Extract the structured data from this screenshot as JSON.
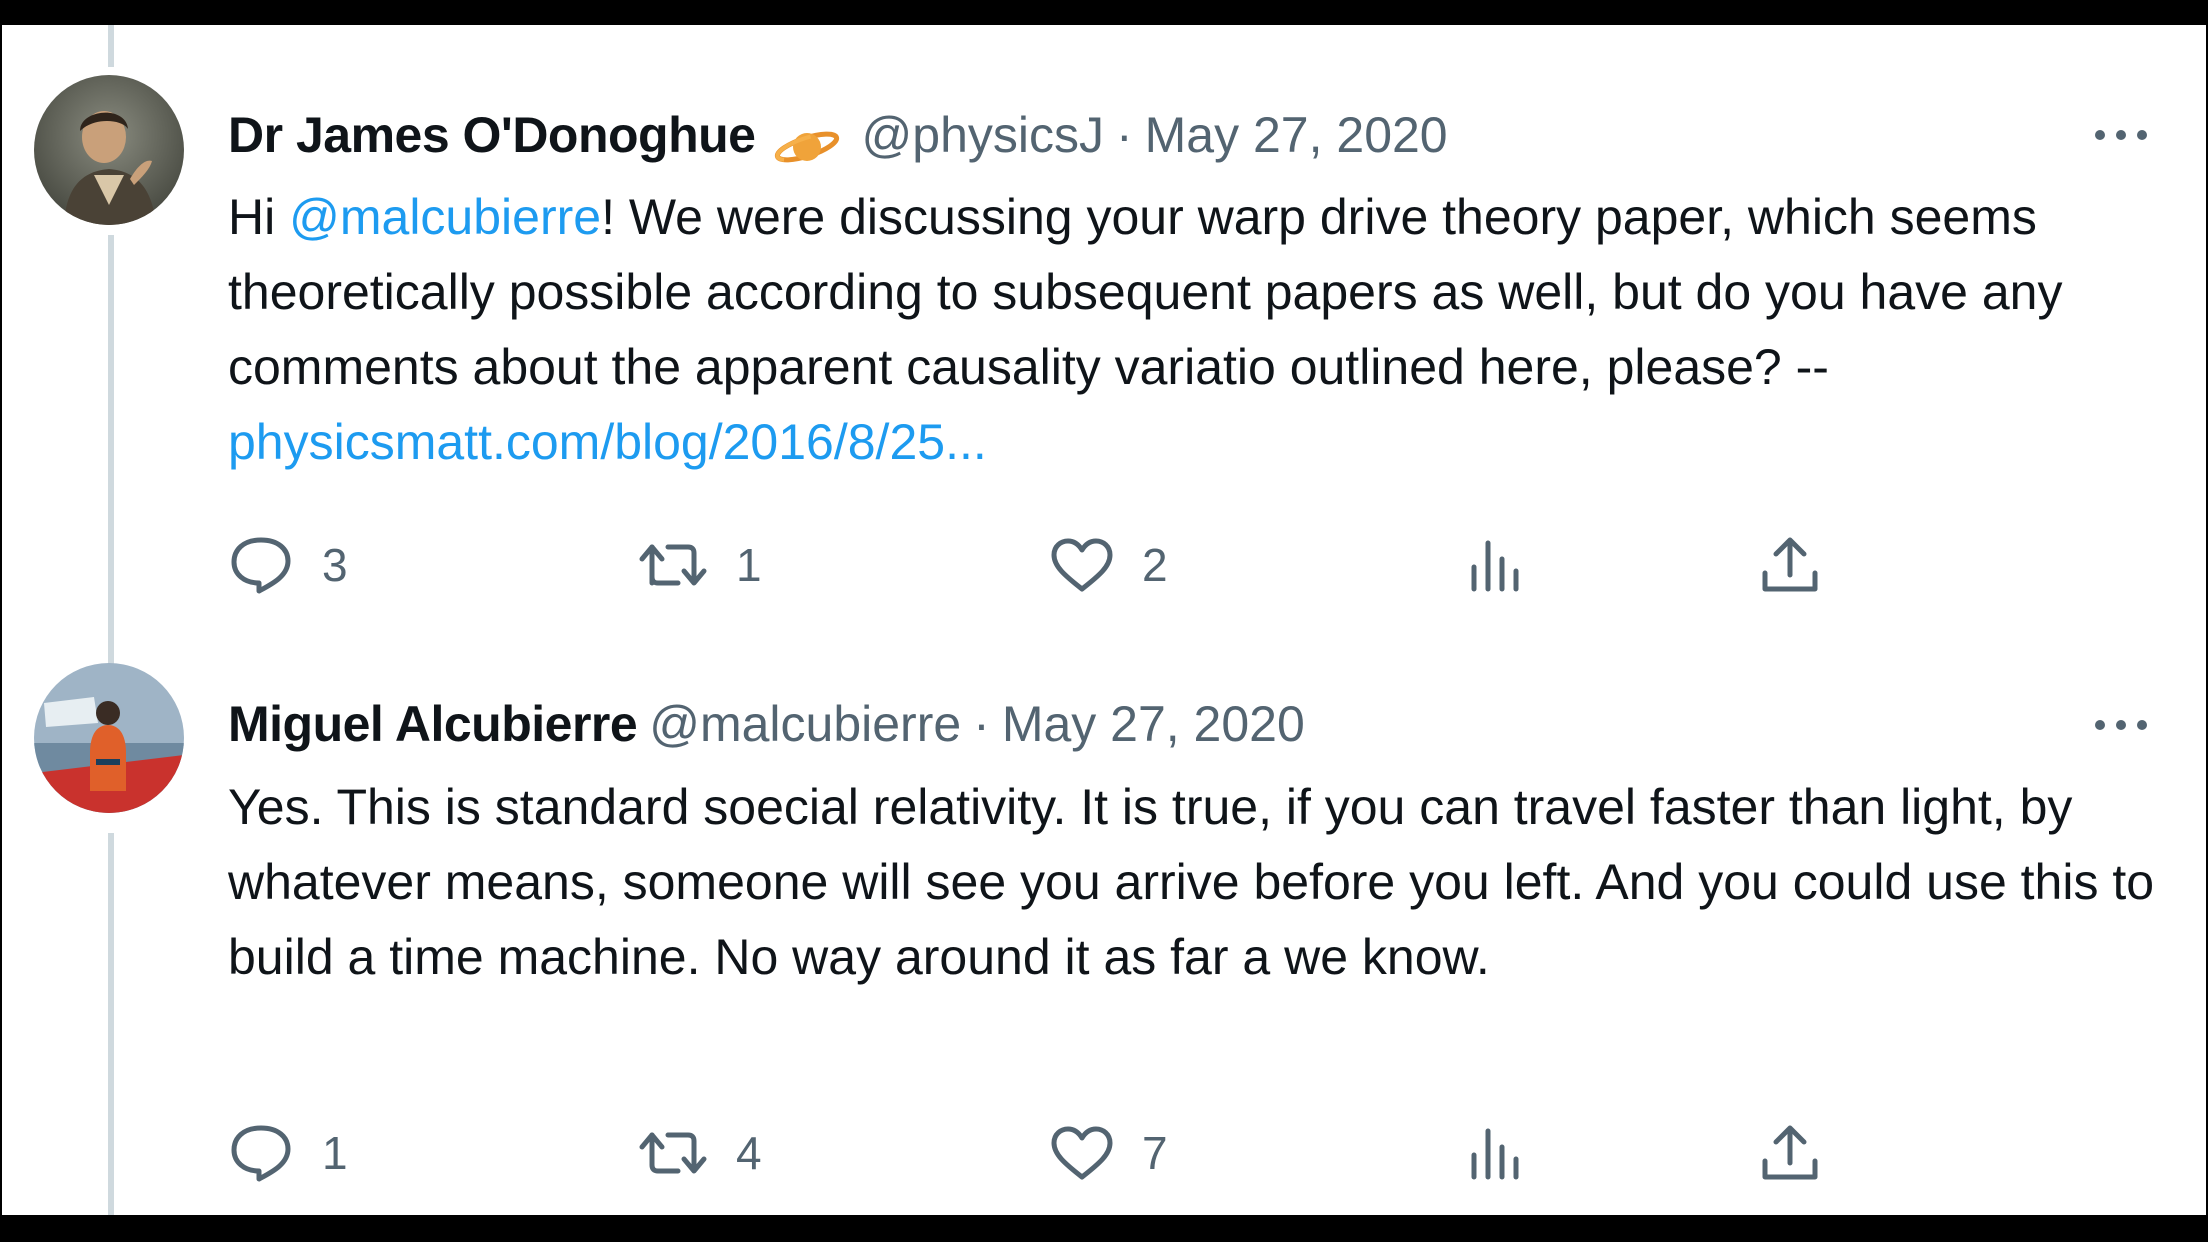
{
  "tweets": [
    {
      "author_name": "Dr James O'Donoghue",
      "has_badge": true,
      "handle": "@physicsJ",
      "separator": "·",
      "date": "May 27, 2020",
      "body": {
        "prefix": "Hi ",
        "mention": "@malcubierre",
        "text": "! We were discussing your warp drive theory paper, which seems theoretically possible according to subsequent papers as well, but do you have any comments about the apparent causality variatio outlined here, please? -- ",
        "link": "physicsmatt.com/blog/2016/8/25..."
      },
      "counts": {
        "replies": "3",
        "retweets": "1",
        "likes": "2"
      }
    },
    {
      "author_name": "Miguel Alcubierre",
      "has_badge": false,
      "handle": "@malcubierre",
      "separator": "·",
      "date": "May 27, 2020",
      "body": {
        "text": "Yes. This is standard soecial relativity. It is true, if you can travel faster than light, by whatever means, someone will see you arrive before you left. And you could use this to build a time machine. No way around it as far a we know."
      },
      "counts": {
        "replies": "1",
        "retweets": "4",
        "likes": "7"
      }
    }
  ],
  "icons": {
    "more": "more-horizontal-icon",
    "reply": "reply-bubble-icon",
    "retweet": "retweet-icon",
    "like": "heart-icon",
    "views": "views-bar-chart-icon",
    "share": "share-upload-icon",
    "badge": "planet-emoji-icon"
  },
  "colors": {
    "text": "#0f1419",
    "secondary": "#536471",
    "link": "#1d9bf0",
    "thread_line": "#cfd9de",
    "background": "#ffffff",
    "letterbox": "#000000"
  }
}
